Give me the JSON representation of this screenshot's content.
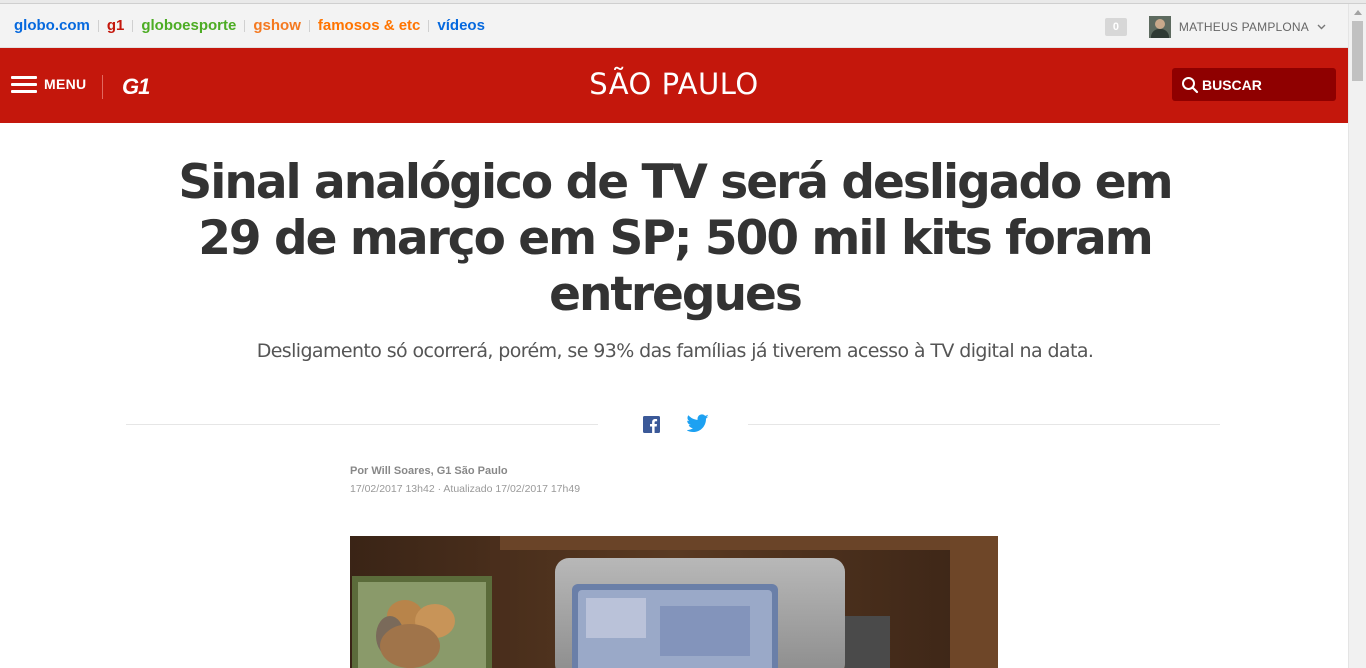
{
  "globo_bar": {
    "links": [
      {
        "label": "globo.com",
        "color": "#0669de"
      },
      {
        "label": "g1",
        "color": "#c4170c"
      },
      {
        "label": "globoesporte",
        "color": "#4cac23"
      },
      {
        "label": "gshow",
        "color": "#f47920"
      },
      {
        "label": "famosos & etc",
        "color": "#ff7400"
      },
      {
        "label": "vídeos",
        "color": "#0669de"
      }
    ],
    "notification_count": "0",
    "user_name": "MATHEUS PAMPLONA"
  },
  "header": {
    "menu_label": "MENU",
    "logo": "G1",
    "section": "SÃO PAULO",
    "search_label": "BUSCAR",
    "brand_color": "#c4170c"
  },
  "article": {
    "headline": "Sinal analógico de TV será desligado em 29 de março em SP; 500 mil kits foram entregues",
    "subhead": "Desligamento só ocorrerá, porém, se 93% das famílias já tiverem acesso à TV digital na data.",
    "byline": "Por Will Soares, G1 São Paulo",
    "timestamp": "17/02/2017 13h42 · Atualizado 17/02/2017 17h49",
    "share": [
      "facebook-icon",
      "twitter-icon"
    ]
  }
}
